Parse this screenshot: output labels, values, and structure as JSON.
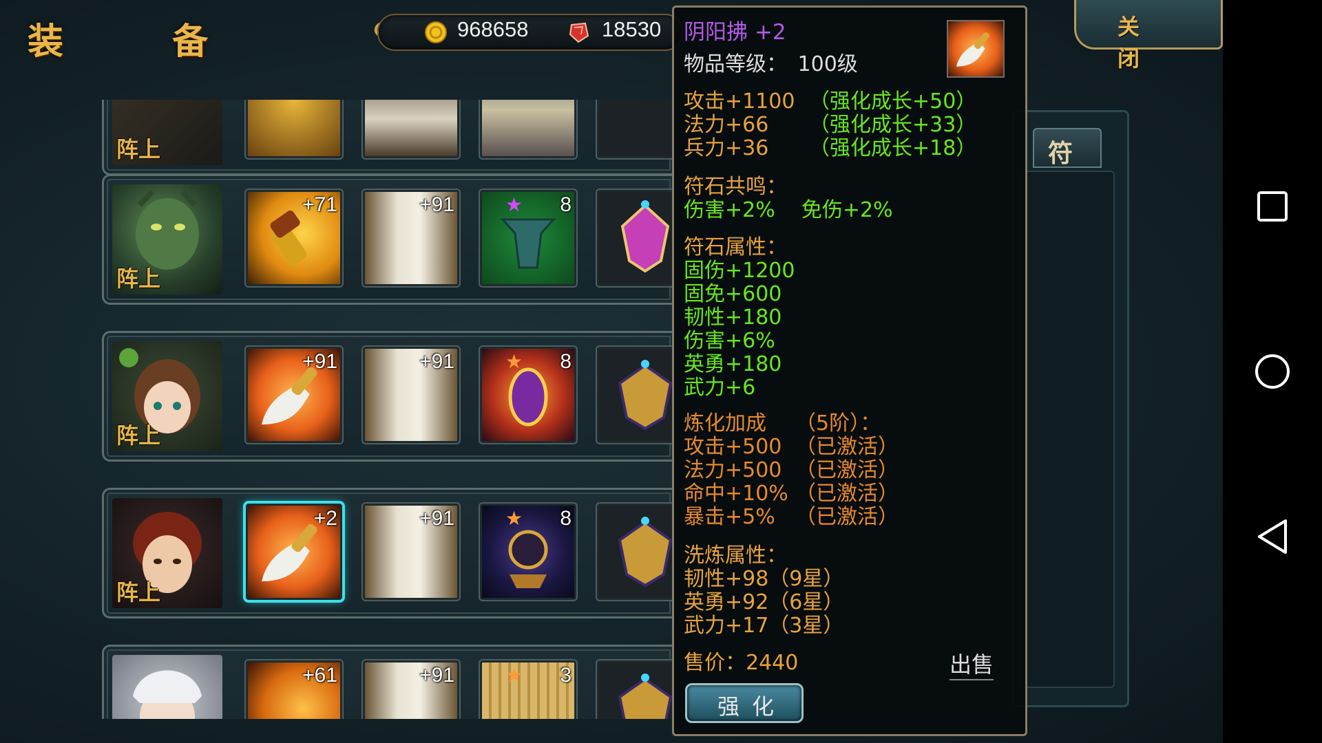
{
  "header": {
    "title": "装 备",
    "gold_value": "968658",
    "gem_value": "18530",
    "close_label": "关 闭"
  },
  "side_tab": {
    "label": "符"
  },
  "roster": [
    {
      "status": "阵上",
      "slots": [
        {
          "level": "",
          "count": ""
        },
        {
          "level": "",
          "count": ""
        },
        {
          "level": "",
          "count": ""
        },
        {
          "level": "",
          "count": ""
        }
      ]
    },
    {
      "status": "阵上",
      "slots": [
        {
          "level": "+71"
        },
        {
          "level": "+91"
        },
        {
          "count": "8"
        },
        {
          "level": ""
        }
      ]
    },
    {
      "status": "阵上",
      "slots": [
        {
          "level": "+91"
        },
        {
          "level": "+91"
        },
        {
          "count": "8"
        },
        {
          "level": ""
        }
      ]
    },
    {
      "status": "阵上",
      "slots": [
        {
          "level": "+2"
        },
        {
          "level": "+91"
        },
        {
          "count": "8"
        },
        {
          "level": ""
        }
      ]
    },
    {
      "status": "",
      "slots": [
        {
          "level": "+61"
        },
        {
          "level": "+91"
        },
        {
          "count": "3"
        },
        {
          "level": ""
        }
      ]
    }
  ],
  "tooltip": {
    "item_name": "阴阳拂 +2",
    "item_level_label": "物品等级：",
    "item_level": "100级",
    "base_stats": [
      {
        "stat": "攻击+1100",
        "growth": "（强化成长+50）"
      },
      {
        "stat": "法力+66",
        "growth": "（强化成长+33）"
      },
      {
        "stat": "兵力+36",
        "growth": "（强化成长+18）"
      }
    ],
    "resonance_title": "符石共鸣：",
    "resonance_line": "伤害+2%    免伤+2%",
    "rune_title": "符石属性：",
    "rune_stats": [
      "固伤+1200",
      "固免+600",
      "韧性+180",
      "伤害+6%",
      "英勇+180",
      "武力+6"
    ],
    "refine_title": "炼化加成",
    "refine_tier": "（5阶）：",
    "refine_stats": [
      {
        "stat": "攻击+500",
        "state": "（已激活）"
      },
      {
        "stat": "法力+500",
        "state": "（已激活）"
      },
      {
        "stat": "命中+10%",
        "state": "（已激活）"
      },
      {
        "stat": "暴击+5%",
        "state": "（已激活）"
      }
    ],
    "wash_title": "洗炼属性：",
    "wash_stats": [
      "韧性+98（9星）",
      "英勇+92（6星）",
      "武力+17（3星）"
    ],
    "price_label": "售价：",
    "price_value": "2440",
    "sell_label": "出售",
    "strengthen_label": "强化"
  }
}
